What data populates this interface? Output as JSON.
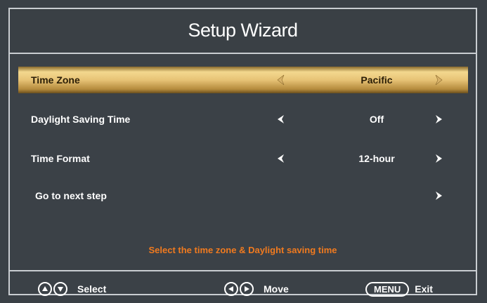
{
  "title": "Setup Wizard",
  "rows": [
    {
      "label": "Time Zone",
      "value": "Pacific",
      "selected": true
    },
    {
      "label": "Daylight Saving Time",
      "value": "Off",
      "selected": false
    },
    {
      "label": "Time Format",
      "value": "12-hour",
      "selected": false
    },
    {
      "label": "Go to next step",
      "value": "",
      "selected": false
    }
  ],
  "hint": "Select the time zone & Daylight saving time",
  "footer": {
    "select_label": "Select",
    "move_label": "Move",
    "menu_key": "MENU",
    "exit_label": "Exit"
  },
  "colors": {
    "selected_row": "#e7c376",
    "hint_text": "#f07a1f",
    "background": "#3b4147"
  },
  "icons": {
    "up": "up-arrow-icon",
    "down": "down-arrow-icon",
    "left": "left-arrow-icon",
    "right": "right-arrow-icon"
  }
}
